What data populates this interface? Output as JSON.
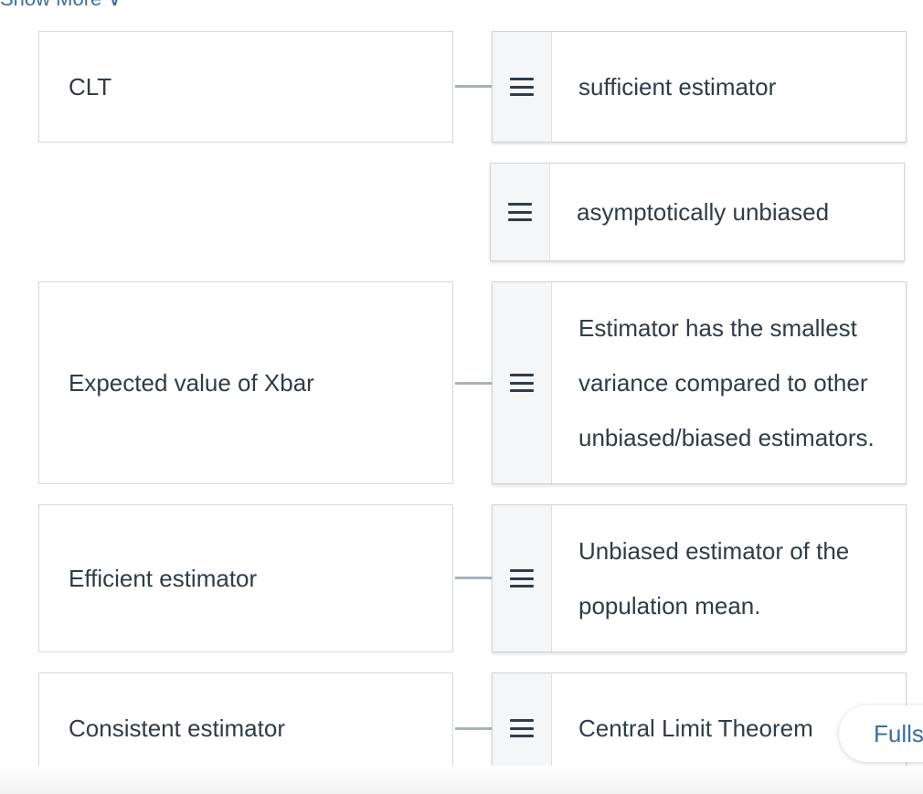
{
  "header": {
    "show_more_label": "Show More ∨"
  },
  "terms": [
    {
      "label": "CLT"
    },
    {
      "label": "Expected value of Xbar"
    },
    {
      "label": "Efficient estimator"
    },
    {
      "label": "Consistent estimator"
    }
  ],
  "answers": [
    {
      "text": "sufficient estimator"
    },
    {
      "text": "asymptotically unbiased"
    },
    {
      "text": "Estimator has the smallest variance compared to other unbiased/biased estimators."
    },
    {
      "text": "Unbiased estimator of the population mean."
    },
    {
      "text": "Central Limit Theorem"
    }
  ],
  "fullscreen": {
    "label": "Fullscreen",
    "icon": "expand-icon"
  },
  "colors": {
    "accent": "#3a6ea5",
    "text": "#2f3c48",
    "border": "#d2d7dc",
    "handle_bg": "#f5f6f7"
  }
}
